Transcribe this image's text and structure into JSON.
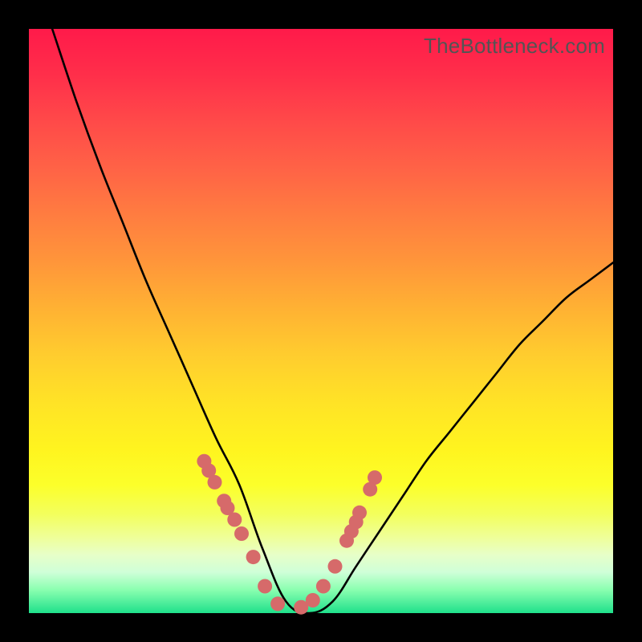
{
  "watermark_text": "TheBottleneck.com",
  "colors": {
    "frame": "#000000",
    "curve": "#000000",
    "dot": "#d66a6a",
    "watermark": "#545454"
  },
  "chart_data": {
    "type": "line",
    "title": "",
    "xlabel": "",
    "ylabel": "",
    "xlim": [
      0,
      100
    ],
    "ylim": [
      0,
      100
    ],
    "grid": false,
    "legend": false,
    "description": "V-shaped bottleneck curve: y ≈ 100 at x=4, dips to y≈0 around x=40–48, rises to y≈60 at x=100. Axes unlabeled; values are visual estimates from pixel positions.",
    "series": [
      {
        "name": "bottleneck-curve",
        "x": [
          4,
          8,
          12,
          16,
          20,
          24,
          28,
          32,
          36,
          40,
          44,
          48,
          52,
          56,
          60,
          64,
          68,
          72,
          76,
          80,
          84,
          88,
          92,
          96,
          100
        ],
        "y": [
          100,
          88,
          77,
          67,
          57,
          48,
          39,
          30,
          22,
          11,
          2,
          0,
          2,
          8,
          14,
          20,
          26,
          31,
          36,
          41,
          46,
          50,
          54,
          57,
          60
        ]
      }
    ],
    "dots": {
      "name": "highlighted-points",
      "x": [
        30.0,
        30.8,
        31.8,
        33.4,
        34.0,
        35.2,
        36.4,
        38.4,
        40.4,
        42.6,
        46.6,
        48.6,
        50.4,
        52.4,
        54.4,
        55.2,
        56.0,
        56.6,
        58.4,
        59.2
      ],
      "y": [
        26.0,
        24.4,
        22.4,
        19.2,
        18.0,
        16.0,
        13.6,
        9.6,
        4.6,
        1.6,
        1.0,
        2.2,
        4.6,
        8.0,
        12.4,
        14.0,
        15.6,
        17.2,
        21.2,
        23.2
      ]
    }
  }
}
